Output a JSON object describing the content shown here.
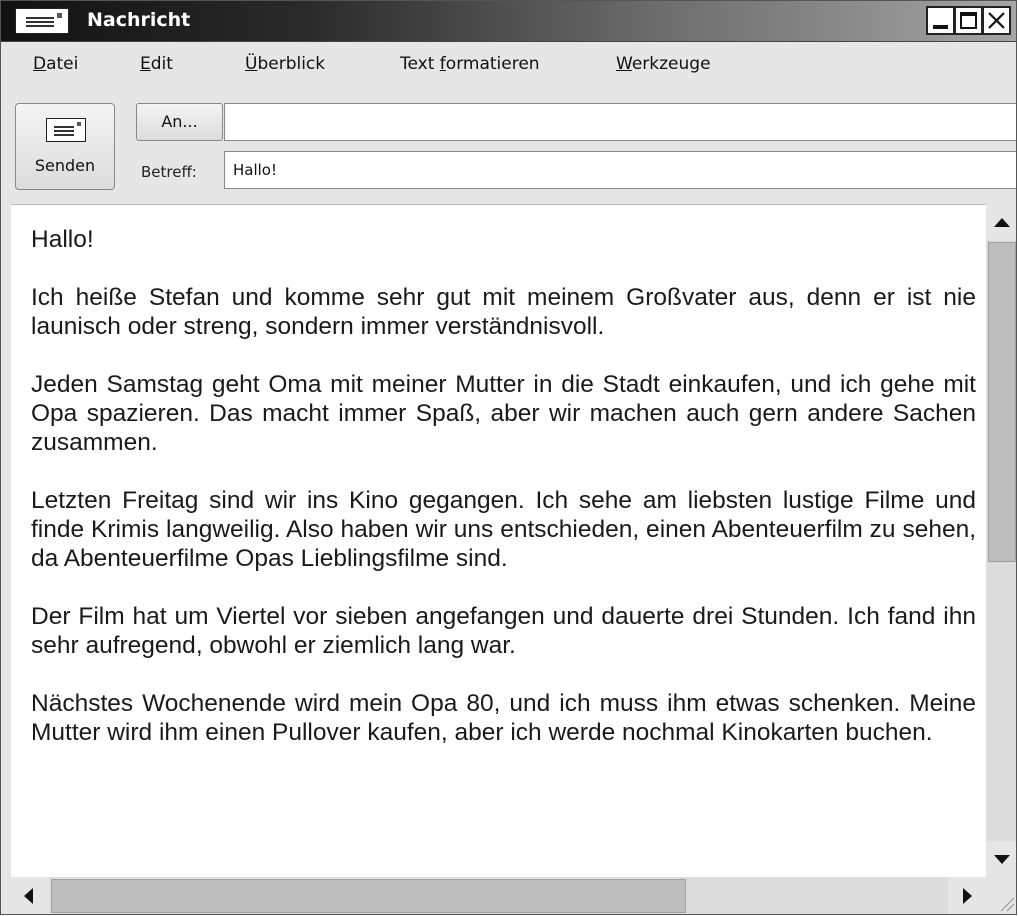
{
  "window": {
    "title": "Nachricht",
    "icon": "envelope-icon"
  },
  "menu": [
    {
      "pre": "",
      "ul": "D",
      "post": "atei"
    },
    {
      "pre": "",
      "ul": "E",
      "post": "dit"
    },
    {
      "pre": "",
      "ul": "Ü",
      "post": "berblick"
    },
    {
      "pre": "Text ",
      "ul": "f",
      "post": "ormatieren"
    },
    {
      "pre": "",
      "ul": "W",
      "post": "erkzeuge"
    }
  ],
  "toolbar": {
    "send_label": "Senden",
    "to_button": "An...",
    "to_value": "",
    "subject_label": "Betreff:",
    "subject_value": "Hallo!"
  },
  "message": {
    "greeting": "Hallo!",
    "paragraphs": [
      "Ich heiße Stefan und komme sehr gut mit meinem Großvater aus, denn er ist nie launisch oder streng, sondern immer verständnisvoll.",
      "Jeden Samstag geht Oma mit meiner Mutter in die Stadt einkaufen, und ich gehe mit Opa spazieren. Das macht immer Spaß, aber wir machen auch gern andere Sachen zusammen.",
      "Letzten Freitag sind wir ins Kino gegangen. Ich sehe am liebsten lustige Filme und finde Krimis langweilig. Also haben wir uns entschieden, einen Abenteuerfilm zu sehen, da Abenteuerfilme Opas Lieblingsfilme sind.",
      "Der Film hat um Viertel vor sieben angefangen und dauerte drei Stunden. Ich fand ihn sehr aufregend, obwohl er ziemlich lang war.",
      "Nächstes Wochenende wird mein Opa 80, und ich muss ihm etwas schenken. Meine Mutter wird ihm einen Pullover kaufen, aber ich werde nochmal Kinokarten buchen."
    ]
  }
}
